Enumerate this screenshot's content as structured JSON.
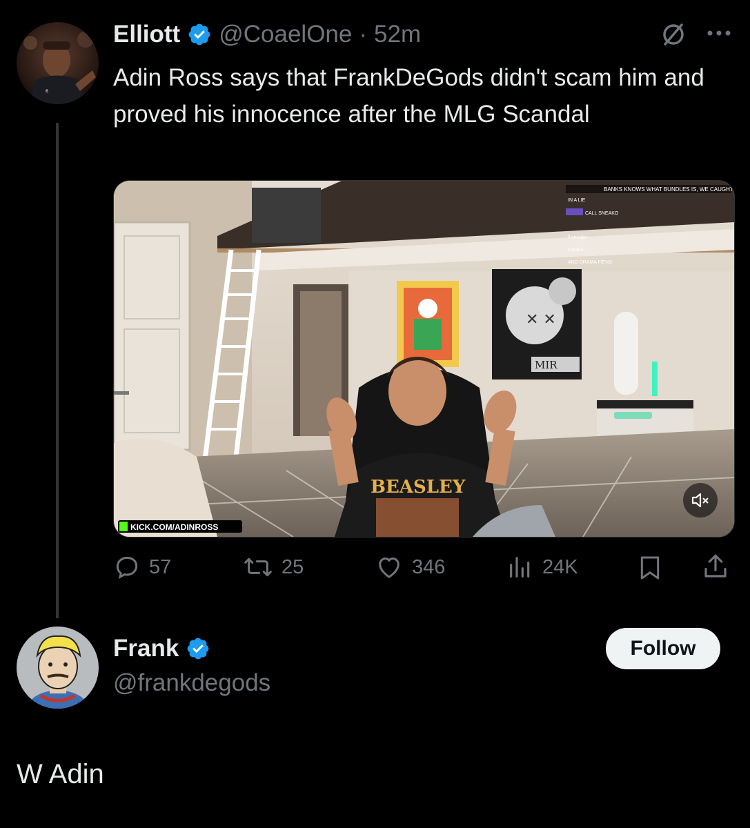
{
  "tweet": {
    "author_name": "Elliott",
    "author_handle": "@CoaelOne",
    "separator": "·",
    "time": "52m",
    "text": "Adin Ross says that FrankDeGods didn't scam him and proved his innocence after the MLG Scandal",
    "media": {
      "watermark": "KICK.COM/ADINROSS",
      "shirt_text": "BEASLEY",
      "chat_lines": [
        "BANKS KNOWS WHAT BUNDLES IS, WE CAUGHT H",
        "IN A LIE",
        "CALL SNEAKO",
        "ll sneako",
        "sneako",
        "AND DRAMA FIENS"
      ],
      "sign_text": "MIR"
    },
    "stats": {
      "replies": "57",
      "reposts": "25",
      "likes": "346",
      "views": "24K"
    }
  },
  "reply": {
    "author_name": "Frank",
    "author_handle": "@frankdegods",
    "follow_label": "Follow",
    "text": "W Adin"
  },
  "colors": {
    "background": "#000000",
    "text": "#e7e9ea",
    "muted": "#71767b",
    "verified": "#1d9bf0",
    "follow_bg": "#eff3f4"
  }
}
